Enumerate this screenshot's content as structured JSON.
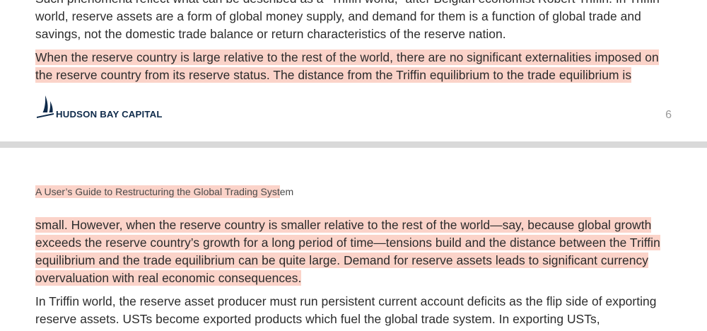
{
  "page_top": {
    "paragraph_1": "Such phenomena reflect what can be described as a “Triffin world,” after Belgian economist Robert Triffin. In Triffin world, reserve assets are a form of global money supply, and demand for them is a function of global trade and savings, not the domestic trade balance or return characteristics of the reserve nation.",
    "paragraph_2": "When the reserve country is large relative to the rest of the world, there are no significant externalities imposed on the reserve country from its reserve status. The distance from the Triffin equilibrium to the trade equilibrium is",
    "footer": {
      "logo_text": "HUDSON BAY CAPITAL",
      "page_number": "6"
    }
  },
  "page_bottom": {
    "running_head_highlighted": "A User’s Guide to Restructuring the Global Trading Syst",
    "running_head_rest": "em",
    "paragraph_1": "small. However, when the reserve country is smaller relative to the rest of the world—say, because global growth exceeds the reserve country’s growth for a long period of time—tensions build and the distance between the Triffin equilibrium and the trade equilibrium can be quite large. Demand for reserve assets leads to significant currency overvaluation with real economic consequences.",
    "paragraph_2": "In Triffin world, the reserve asset producer must run persistent current account deficits as the flip side of exporting reserve assets. USTs become exported products which fuel the global trade system. In exporting USTs,"
  },
  "colors": {
    "highlight": "#fbd3c9",
    "text": "#2b2b2b",
    "logo": "#0e2a4a",
    "page_separator": "#d9d9d9"
  }
}
